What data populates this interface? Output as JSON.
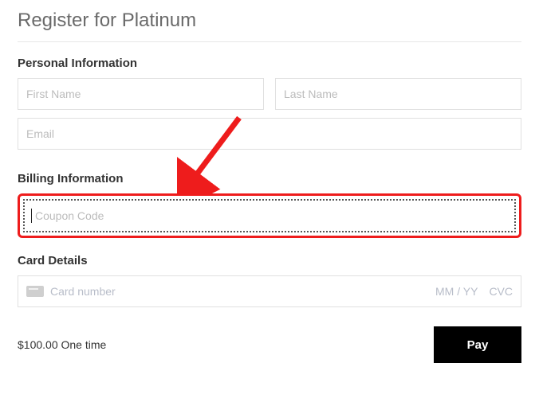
{
  "title": "Register for Platinum",
  "sections": {
    "personal": {
      "header": "Personal Information",
      "first_name_placeholder": "First Name",
      "last_name_placeholder": "Last Name",
      "email_placeholder": "Email"
    },
    "billing": {
      "header": "Billing Information",
      "coupon_placeholder": "Coupon Code"
    },
    "card": {
      "header": "Card Details",
      "number_placeholder": "Card number",
      "expiry_placeholder": "MM / YY",
      "cvc_placeholder": "CVC"
    }
  },
  "footer": {
    "price_text": "$100.00 One time",
    "pay_label": "Pay"
  }
}
